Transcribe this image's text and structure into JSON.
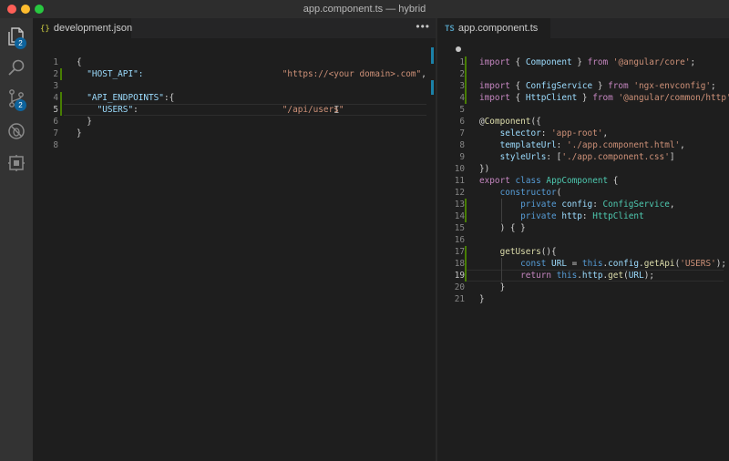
{
  "window": {
    "title": "app.component.ts — hybrid"
  },
  "activity_bar": {
    "explorer_badge": "2",
    "scm_badge": "2",
    "icons": [
      "files-icon",
      "search-icon",
      "source-control-icon",
      "debug-icon",
      "extensions-icon"
    ]
  },
  "left_editor": {
    "tab": {
      "icon": "{}",
      "label": "development.json"
    },
    "more": "•••",
    "lines": [
      {
        "n": "1",
        "tokens": [
          {
            "t": "{",
            "c": "p"
          }
        ]
      },
      {
        "n": "2",
        "tokens": [
          {
            "t": "  \"HOST_API\":                           ",
            "c": "v"
          },
          {
            "t": "\"https://<your domain>.com\"",
            "c": "s"
          },
          {
            "t": ",",
            "c": "p"
          }
        ]
      },
      {
        "n": "3",
        "tokens": []
      },
      {
        "n": "4",
        "tokens": [
          {
            "t": "  \"API_ENDPOINTS\"",
            "c": "v"
          },
          {
            "t": ":{",
            "c": "p"
          }
        ]
      },
      {
        "n": "5",
        "tokens": [
          {
            "t": "    \"USERS\"",
            "c": "v"
          },
          {
            "t": ":                            ",
            "c": "p"
          },
          {
            "t": "\"/api/users\"",
            "c": "s"
          }
        ]
      },
      {
        "n": "6",
        "tokens": [
          {
            "t": "  }",
            "c": "p"
          }
        ]
      },
      {
        "n": "7",
        "tokens": [
          {
            "t": "}",
            "c": "p"
          }
        ]
      },
      {
        "n": "8",
        "tokens": []
      }
    ]
  },
  "right_editor": {
    "tab": {
      "icon": "TS",
      "label": "app.component.ts"
    },
    "lines": [
      {
        "n": "1",
        "tokens": [
          {
            "t": "import",
            "c": "c"
          },
          {
            "t": " { ",
            "c": "p"
          },
          {
            "t": "Component",
            "c": "v"
          },
          {
            "t": " } ",
            "c": "p"
          },
          {
            "t": "from",
            "c": "c"
          },
          {
            "t": " ",
            "c": "p"
          },
          {
            "t": "'@angular/core'",
            "c": "s"
          },
          {
            "t": ";",
            "c": "p"
          }
        ]
      },
      {
        "n": "2",
        "tokens": []
      },
      {
        "n": "3",
        "tokens": [
          {
            "t": "import",
            "c": "c"
          },
          {
            "t": " { ",
            "c": "p"
          },
          {
            "t": "ConfigService",
            "c": "v"
          },
          {
            "t": " } ",
            "c": "p"
          },
          {
            "t": "from",
            "c": "c"
          },
          {
            "t": " ",
            "c": "p"
          },
          {
            "t": "'ngx-envconfig'",
            "c": "s"
          },
          {
            "t": ";",
            "c": "p"
          }
        ]
      },
      {
        "n": "4",
        "tokens": [
          {
            "t": "import",
            "c": "c"
          },
          {
            "t": " { ",
            "c": "p"
          },
          {
            "t": "HttpClient",
            "c": "v"
          },
          {
            "t": " } ",
            "c": "p"
          },
          {
            "t": "from",
            "c": "c"
          },
          {
            "t": " ",
            "c": "p"
          },
          {
            "t": "'@angular/common/http'",
            "c": "s"
          },
          {
            "t": ";",
            "c": "p"
          }
        ]
      },
      {
        "n": "5",
        "tokens": []
      },
      {
        "n": "6",
        "tokens": [
          {
            "t": "@",
            "c": "p"
          },
          {
            "t": "Component",
            "c": "f"
          },
          {
            "t": "({",
            "c": "p"
          }
        ]
      },
      {
        "n": "7",
        "tokens": [
          {
            "t": "    selector",
            "c": "v"
          },
          {
            "t": ": ",
            "c": "p"
          },
          {
            "t": "'app-root'",
            "c": "s"
          },
          {
            "t": ",",
            "c": "p"
          }
        ]
      },
      {
        "n": "8",
        "tokens": [
          {
            "t": "    templateUrl",
            "c": "v"
          },
          {
            "t": ": ",
            "c": "p"
          },
          {
            "t": "'./app.component.html'",
            "c": "s"
          },
          {
            "t": ",",
            "c": "p"
          }
        ]
      },
      {
        "n": "9",
        "tokens": [
          {
            "t": "    styleUrls",
            "c": "v"
          },
          {
            "t": ": [",
            "c": "p"
          },
          {
            "t": "'./app.component.css'",
            "c": "s"
          },
          {
            "t": "]",
            "c": "p"
          }
        ]
      },
      {
        "n": "10",
        "tokens": [
          {
            "t": "})",
            "c": "p"
          }
        ]
      },
      {
        "n": "11",
        "tokens": [
          {
            "t": "export",
            "c": "c"
          },
          {
            "t": " ",
            "c": "p"
          },
          {
            "t": "class",
            "c": "k"
          },
          {
            "t": " ",
            "c": "p"
          },
          {
            "t": "AppComponent",
            "c": "t"
          },
          {
            "t": " {",
            "c": "p"
          }
        ]
      },
      {
        "n": "12",
        "tokens": [
          {
            "t": "    ",
            "c": "p"
          },
          {
            "t": "constructor",
            "c": "k"
          },
          {
            "t": "(",
            "c": "p"
          }
        ]
      },
      {
        "n": "13",
        "tokens": [
          {
            "t": "        ",
            "c": "p"
          },
          {
            "t": "private",
            "c": "k"
          },
          {
            "t": " ",
            "c": "p"
          },
          {
            "t": "config",
            "c": "v"
          },
          {
            "t": ": ",
            "c": "p"
          },
          {
            "t": "ConfigService",
            "c": "t"
          },
          {
            "t": ",",
            "c": "p"
          }
        ]
      },
      {
        "n": "14",
        "tokens": [
          {
            "t": "        ",
            "c": "p"
          },
          {
            "t": "private",
            "c": "k"
          },
          {
            "t": " ",
            "c": "p"
          },
          {
            "t": "http",
            "c": "v"
          },
          {
            "t": ": ",
            "c": "p"
          },
          {
            "t": "HttpClient",
            "c": "t"
          }
        ]
      },
      {
        "n": "15",
        "tokens": [
          {
            "t": "    ) { }",
            "c": "p"
          }
        ]
      },
      {
        "n": "16",
        "tokens": []
      },
      {
        "n": "17",
        "tokens": [
          {
            "t": "    ",
            "c": "p"
          },
          {
            "t": "getUsers",
            "c": "f"
          },
          {
            "t": "(){",
            "c": "p"
          }
        ]
      },
      {
        "n": "18",
        "tokens": [
          {
            "t": "        ",
            "c": "p"
          },
          {
            "t": "const",
            "c": "k"
          },
          {
            "t": " ",
            "c": "p"
          },
          {
            "t": "URL",
            "c": "v"
          },
          {
            "t": " = ",
            "c": "p"
          },
          {
            "t": "this",
            "c": "k"
          },
          {
            "t": ".",
            "c": "p"
          },
          {
            "t": "config",
            "c": "v"
          },
          {
            "t": ".",
            "c": "p"
          },
          {
            "t": "getApi",
            "c": "f"
          },
          {
            "t": "(",
            "c": "p"
          },
          {
            "t": "'USERS'",
            "c": "s"
          },
          {
            "t": ");",
            "c": "p"
          }
        ]
      },
      {
        "n": "19",
        "tokens": [
          {
            "t": "        ",
            "c": "p"
          },
          {
            "t": "return",
            "c": "c"
          },
          {
            "t": " ",
            "c": "p"
          },
          {
            "t": "this",
            "c": "k"
          },
          {
            "t": ".",
            "c": "p"
          },
          {
            "t": "http",
            "c": "v"
          },
          {
            "t": ".",
            "c": "p"
          },
          {
            "t": "get",
            "c": "f"
          },
          {
            "t": "(",
            "c": "p"
          },
          {
            "t": "URL",
            "c": "v"
          },
          {
            "t": ");",
            "c": "p"
          }
        ]
      },
      {
        "n": "20",
        "tokens": [
          {
            "t": "    }",
            "c": "p"
          }
        ]
      },
      {
        "n": "21",
        "tokens": [
          {
            "t": "}",
            "c": "p"
          }
        ]
      }
    ]
  }
}
